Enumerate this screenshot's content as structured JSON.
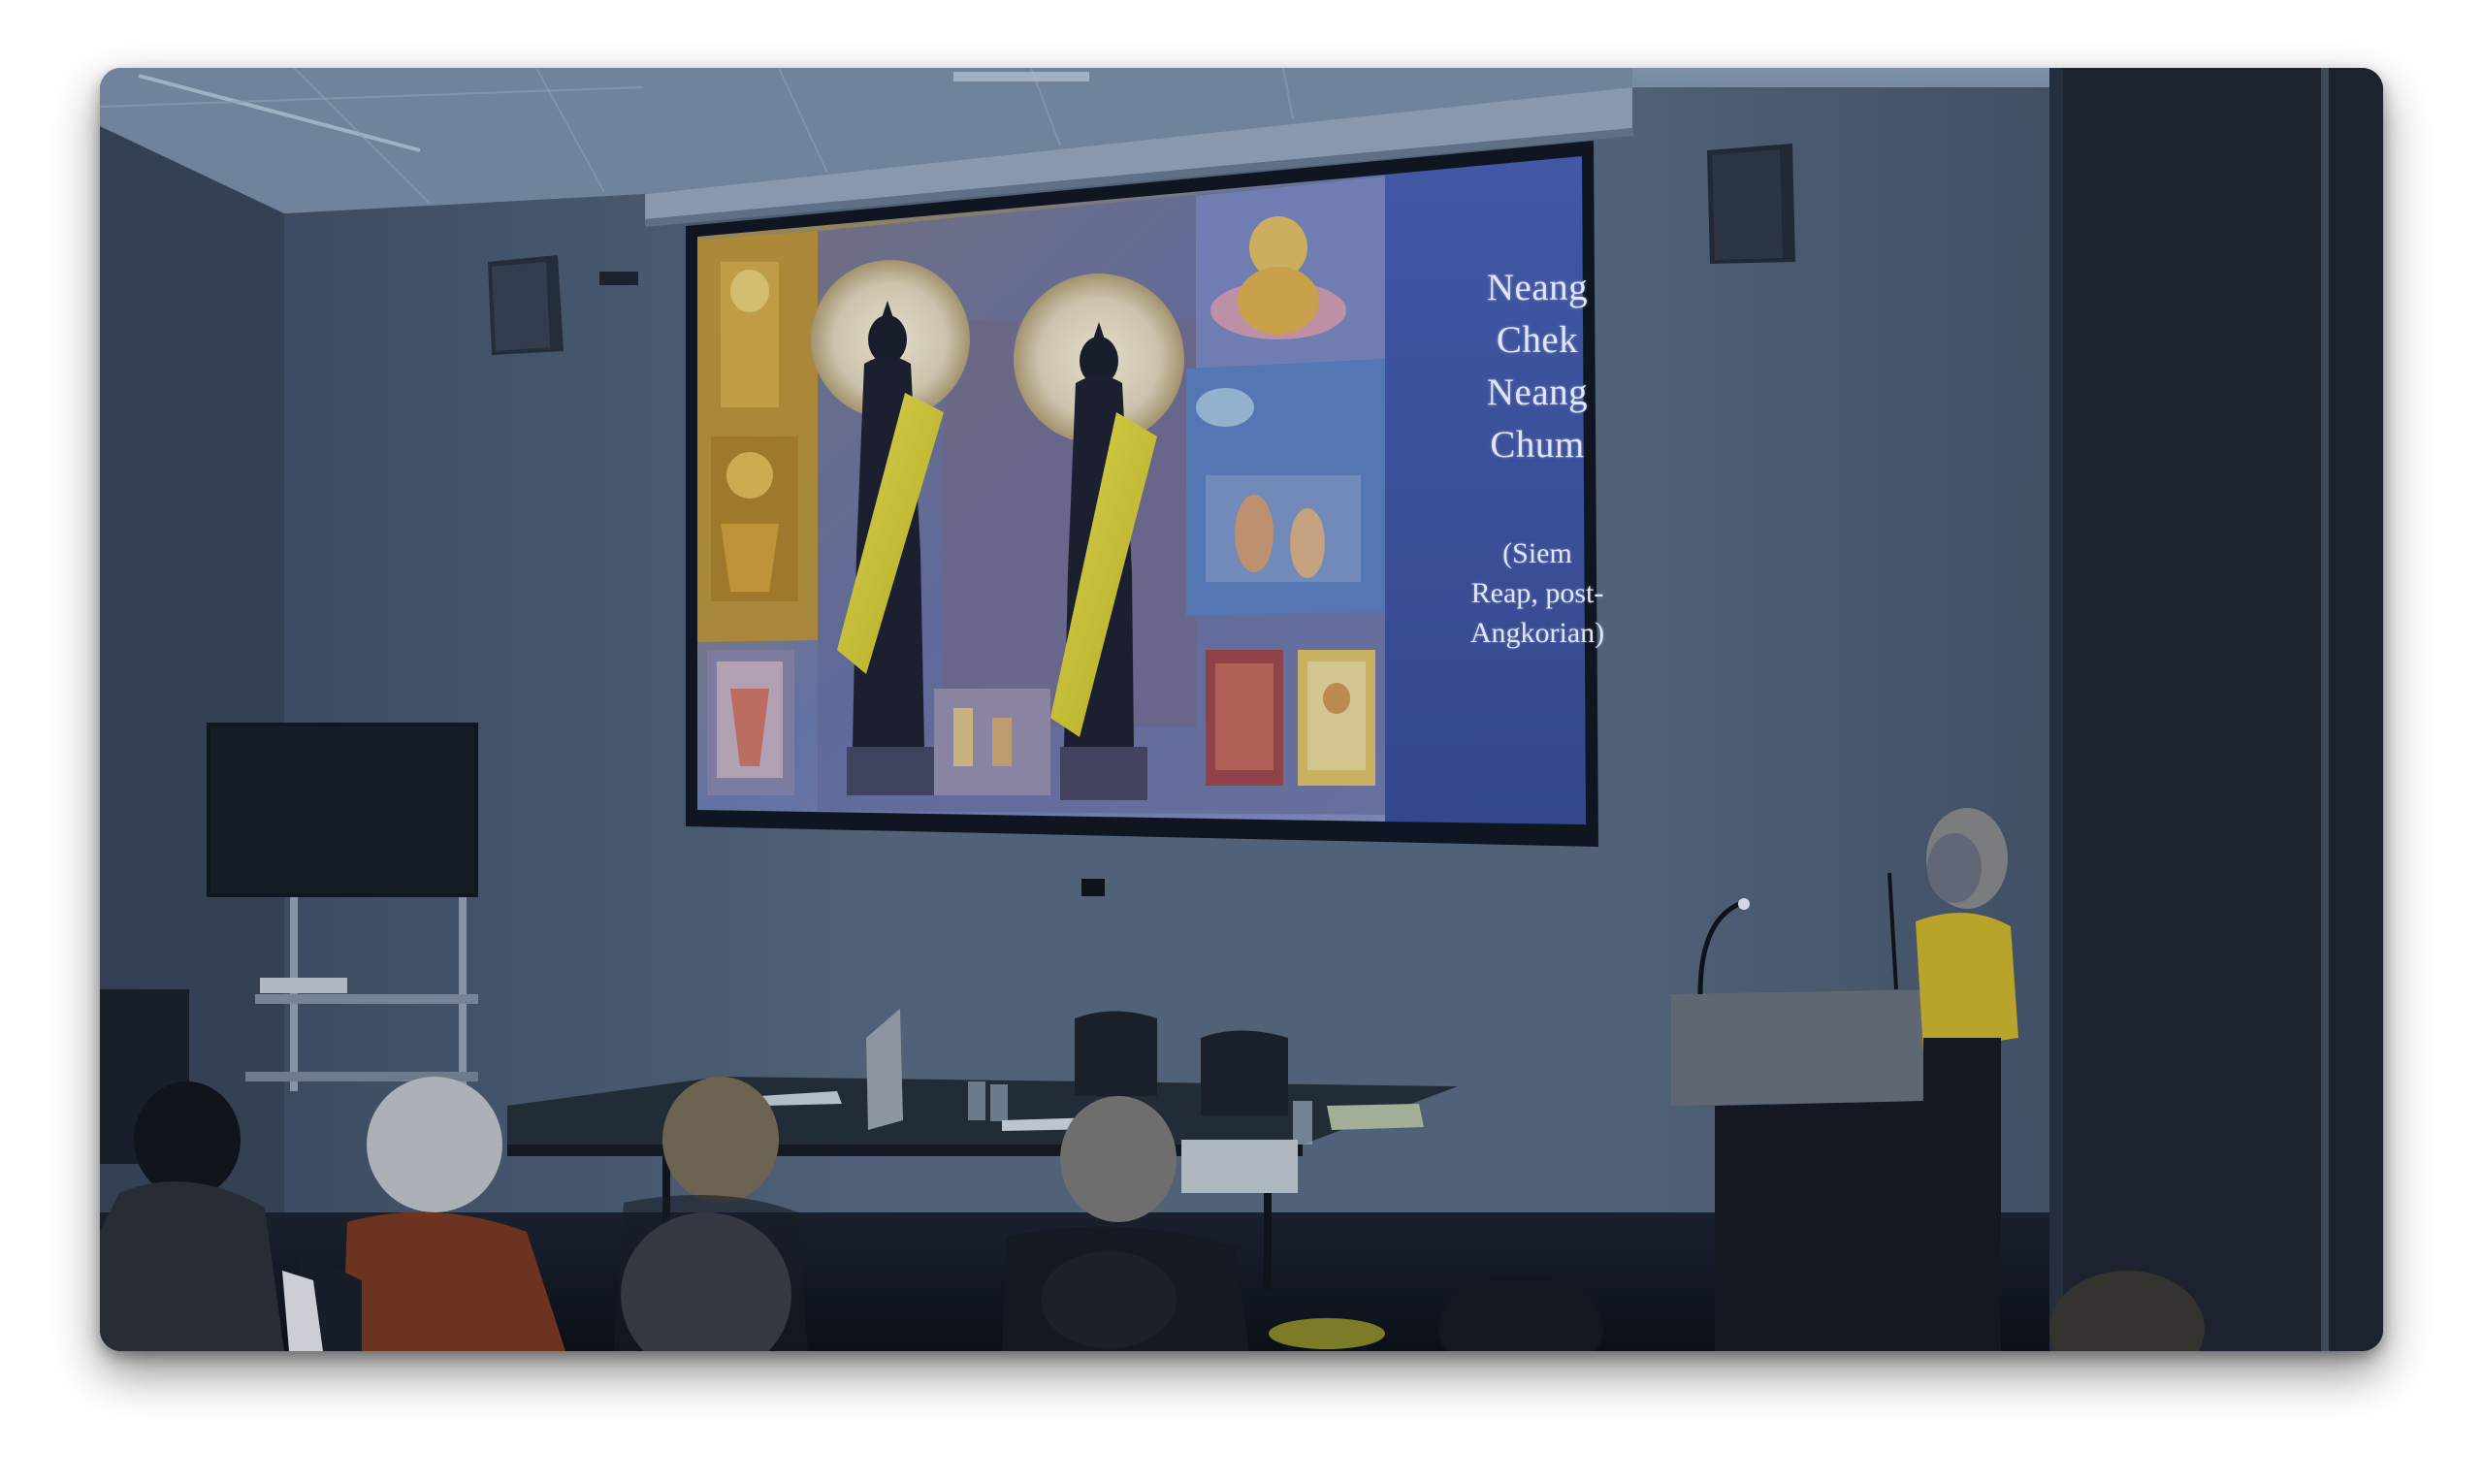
{
  "slide": {
    "title_lines": [
      "Neang",
      "Chek",
      "Neang",
      "Chum"
    ],
    "caption_lines": [
      "(Siem",
      "Reap, post-",
      "Angkorian)"
    ]
  },
  "colors": {
    "room_wall": "#56697f",
    "ceiling": "#7b8fa8",
    "screen_panel": "#3f56a8",
    "sash_yellow": "#e6df3a",
    "presenter_shirt": "#d9c52a"
  }
}
